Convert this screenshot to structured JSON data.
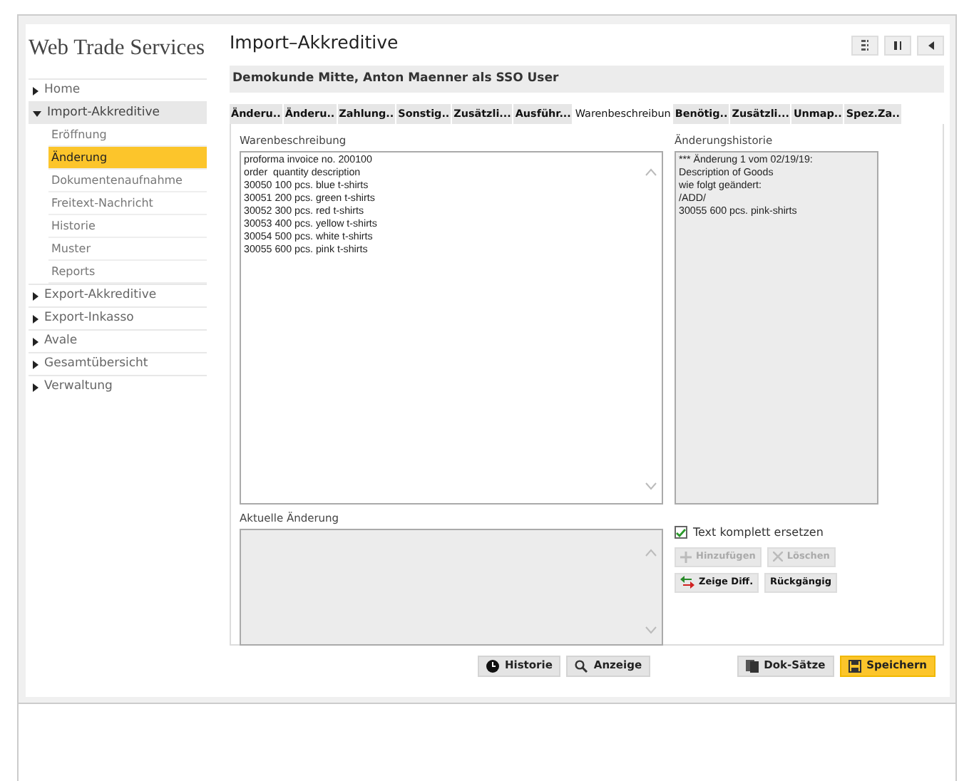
{
  "sidebar": {
    "title": "Web Trade Services",
    "items": [
      {
        "label": "Home",
        "expanded": false
      },
      {
        "label": "Import-Akkreditive",
        "expanded": true,
        "children": [
          {
            "label": "Eröffnung",
            "selected": false
          },
          {
            "label": "Änderung",
            "selected": true
          },
          {
            "label": "Dokumentenaufnahme",
            "selected": false
          },
          {
            "label": "Freitext-Nachricht",
            "selected": false
          },
          {
            "label": "Historie",
            "selected": false
          },
          {
            "label": "Muster",
            "selected": false
          },
          {
            "label": "Reports",
            "selected": false
          }
        ]
      },
      {
        "label": "Export-Akkreditive",
        "expanded": false
      },
      {
        "label": "Export-Inkasso",
        "expanded": false
      },
      {
        "label": "Avale",
        "expanded": false
      },
      {
        "label": "Gesamtübersicht",
        "expanded": false
      },
      {
        "label": "Verwaltung",
        "expanded": false
      }
    ]
  },
  "header": {
    "title": "Import–Akkreditive",
    "user": "Demokunde Mitte, Anton Maenner als SSO User"
  },
  "tabs": [
    {
      "label": "Änderu..",
      "selected": false
    },
    {
      "label": "Änderu..",
      "selected": false
    },
    {
      "label": "Zahlung..",
      "selected": false
    },
    {
      "label": "Sonstig..",
      "selected": false
    },
    {
      "label": "Zusätzli...",
      "selected": false
    },
    {
      "label": "Ausführ...",
      "selected": false
    },
    {
      "label": "Warenbeschreibun",
      "selected": true
    },
    {
      "label": "Benötig..",
      "selected": false
    },
    {
      "label": "Zusätzli...",
      "selected": false
    },
    {
      "label": "Unmap..",
      "selected": false
    },
    {
      "label": "Spez.Za..",
      "selected": false
    }
  ],
  "goods": {
    "label": "Warenbeschreibung",
    "value": "proforma invoice no. 200100\norder  quantity description\n30050 100 pcs. blue t-shirts\n30051 200 pcs. green t-shirts\n30052 300 pcs. red t-shirts\n30053 400 pcs. yellow t-shirts\n30054 500 pcs. white t-shirts\n30055 600 pcs. pink t-shirts"
  },
  "history": {
    "label": "Änderungshistorie",
    "value": "*** Änderung 1 vom 02/19/19:\nDescription of Goods\nwie folgt geändert:\n/ADD/\n30055 600 pcs. pink-shirts"
  },
  "current": {
    "label": "Aktuelle Änderung"
  },
  "replace": {
    "label": "Text komplett ersetzen",
    "checked": true
  },
  "edit_buttons": [
    {
      "label": "Hinzufügen",
      "disabled": true
    },
    {
      "label": "Löschen",
      "disabled": true
    },
    {
      "label": "Zeige Diff.",
      "disabled": false
    },
    {
      "label": "Rückgängig",
      "disabled": false
    }
  ],
  "footer_buttons": [
    {
      "label": "Historie",
      "primary": false
    },
    {
      "label": "Anzeige",
      "primary": false
    },
    {
      "label": "Dok-Sätze",
      "primary": false
    },
    {
      "label": "Speichern",
      "primary": true
    }
  ]
}
